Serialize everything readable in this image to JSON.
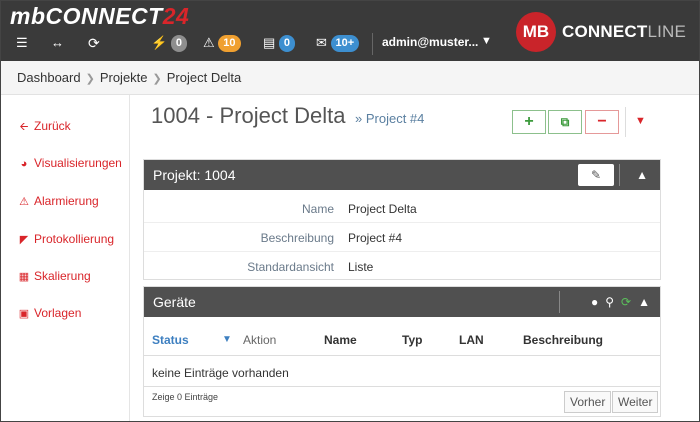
{
  "app": {
    "logo_main": "mbCONNECT",
    "logo_accent": "24",
    "brand_badge": "MB",
    "brand_text_bold": "CONNECT",
    "brand_text_light": "LINE"
  },
  "topbar": {
    "badges": {
      "flash": "0",
      "warning": "10",
      "server": "0",
      "messages": "10+"
    },
    "user": "admin@muster..."
  },
  "breadcrumb": [
    "Dashboard",
    "Projekte",
    "Project Delta"
  ],
  "sidebar": {
    "items": [
      {
        "label": "Zurück",
        "icon": "arrow-left-icon"
      },
      {
        "label": "Visualisierungen",
        "icon": "dashboard-icon"
      },
      {
        "label": "Alarmierung",
        "icon": "warning-icon"
      },
      {
        "label": "Protokollierung",
        "icon": "area-chart-icon"
      },
      {
        "label": "Skalierung",
        "icon": "calculator-icon"
      },
      {
        "label": "Vorlagen",
        "icon": "inbox-icon"
      }
    ]
  },
  "page": {
    "title": "1004 - Project Delta",
    "subtitle": "» Project #4"
  },
  "project_panel": {
    "heading": "Projekt: 1004",
    "fields": [
      {
        "label": "Name",
        "value": "Project Delta"
      },
      {
        "label": "Beschreibung",
        "value": "Project #4"
      },
      {
        "label": "Standardansicht",
        "value": "Liste"
      }
    ]
  },
  "devices_panel": {
    "heading": "Geräte",
    "columns": [
      "Status",
      "Aktion",
      "Name",
      "Typ",
      "LAN",
      "Beschreibung"
    ],
    "empty_text": "keine Einträge vorhanden",
    "count_text": "Zeige 0 Einträge",
    "prev_label": "Vorher",
    "next_label": "Weiter"
  },
  "colors": {
    "accent": "#d9252a",
    "topbar": "#3a3a3a",
    "panel_header": "#505050"
  }
}
